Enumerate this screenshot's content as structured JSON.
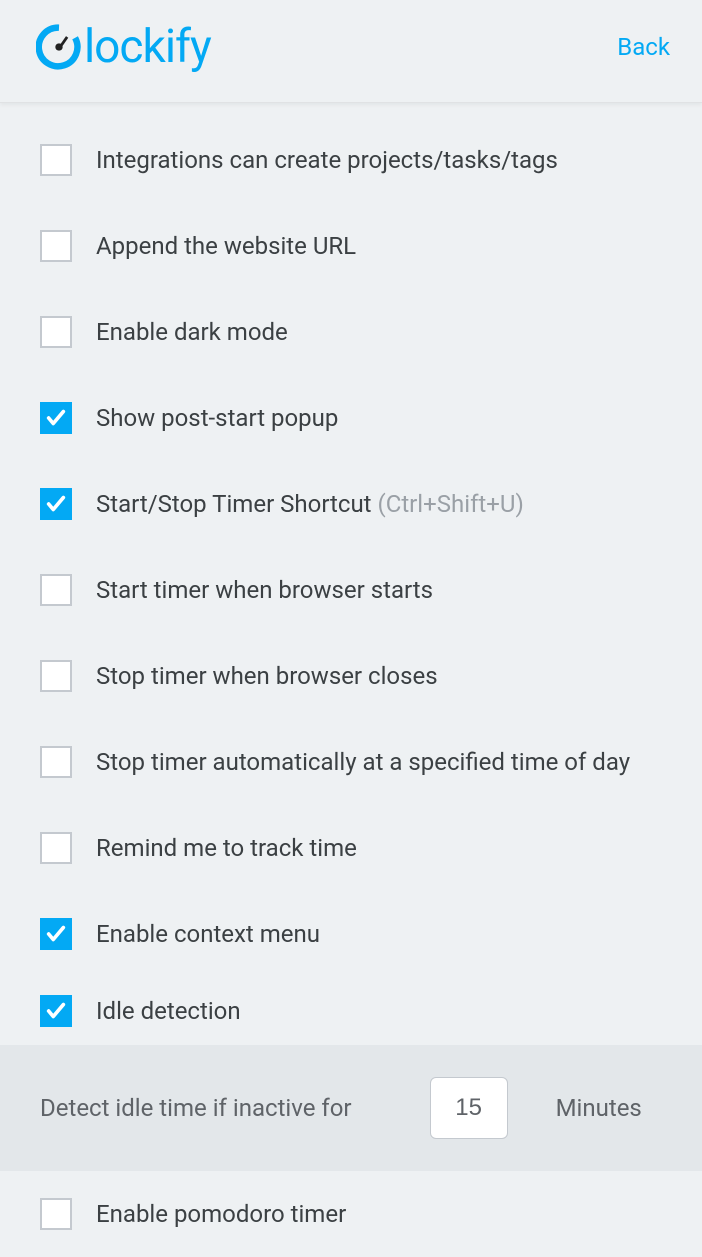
{
  "header": {
    "brand": "lockify",
    "back": "Back"
  },
  "settings": [
    {
      "id": "integrations",
      "label": "Integrations can create projects/tasks/tags",
      "checked": false
    },
    {
      "id": "append-url",
      "label": "Append the website URL",
      "checked": false
    },
    {
      "id": "dark-mode",
      "label": "Enable dark mode",
      "checked": false
    },
    {
      "id": "post-start-popup",
      "label": "Show post-start popup",
      "checked": true
    },
    {
      "id": "timer-shortcut",
      "label": "Start/Stop Timer Shortcut ",
      "hint": "(Ctrl+Shift+U)",
      "checked": true
    },
    {
      "id": "start-browser",
      "label": "Start timer when browser starts",
      "checked": false
    },
    {
      "id": "stop-browser",
      "label": "Stop timer when browser closes",
      "checked": false
    },
    {
      "id": "stop-auto-time",
      "label": "Stop timer automatically at a specified time of day",
      "checked": false
    },
    {
      "id": "remind-track",
      "label": "Remind me to track time",
      "checked": false
    },
    {
      "id": "context-menu",
      "label": "Enable context menu",
      "checked": true
    },
    {
      "id": "idle-detection",
      "label": "Idle detection",
      "checked": true
    }
  ],
  "idle": {
    "label": "Detect idle time if inactive for",
    "value": "15",
    "unit": "Minutes"
  },
  "pomodoro": {
    "label": "Enable pomodoro timer",
    "checked": false
  }
}
